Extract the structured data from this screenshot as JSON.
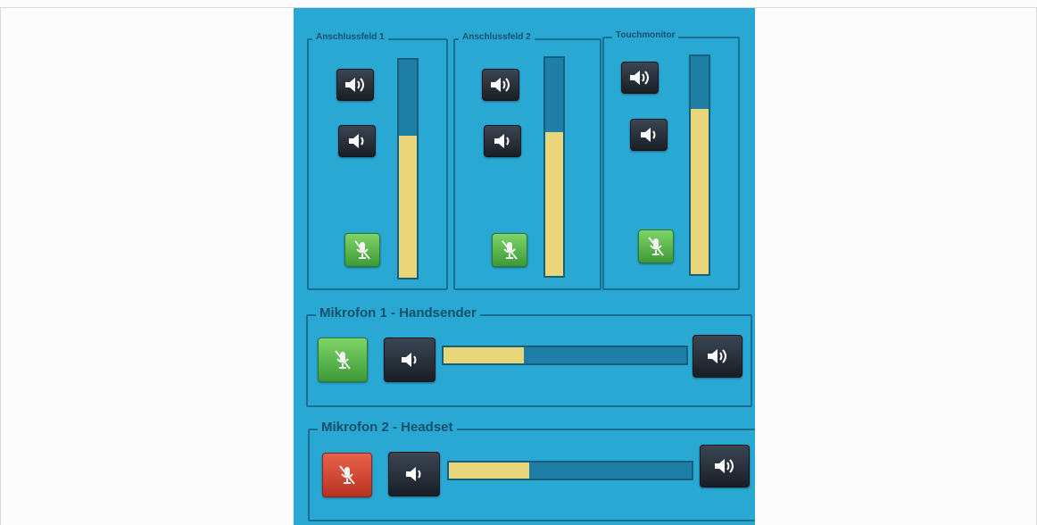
{
  "channels": [
    {
      "label": "Anschlussfeld 1",
      "level": 0.65
    },
    {
      "label": "Anschlussfeld 2",
      "level": 0.66
    },
    {
      "label": "Touchmonitor",
      "level": 0.76
    }
  ],
  "microphones": [
    {
      "label": "Mikrofon 1 - Handsender",
      "level": 0.33,
      "muted": false
    },
    {
      "label": "Mikrofon 2 - Headset",
      "level": 0.33,
      "muted": true
    }
  ],
  "icons": {
    "volume_up": "speaker-loud-icon",
    "volume_down": "speaker-quiet-icon",
    "mic_mute": "microphone-muted-icon"
  },
  "colors": {
    "panel": "#2aa8d4",
    "level_fill": "#ead67a",
    "mic_active": "#5bb84a",
    "mic_muted": "#d44a33"
  }
}
